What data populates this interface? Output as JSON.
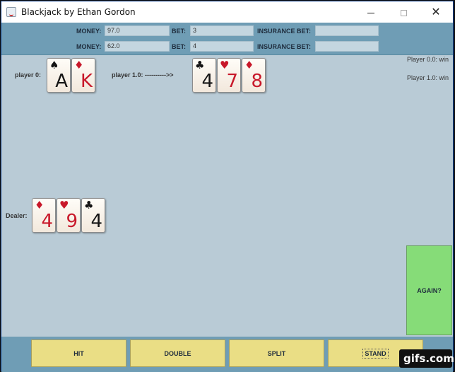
{
  "window": {
    "title": "Blackjack by Ethan Gordon",
    "controls": {
      "minimize": "",
      "maximize": "",
      "close": "✕"
    }
  },
  "bet_panel": {
    "rows": [
      {
        "money_label": "MONEY:",
        "money": "97.0",
        "bet_label": "BET:",
        "bet": "3",
        "insurance_label": "INSURANCE BET:",
        "insurance": ""
      },
      {
        "money_label": "MONEY:",
        "money": "62.0",
        "bet_label": "BET:",
        "bet": "4",
        "insurance_label": "INSURANCE BET:",
        "insurance": ""
      }
    ]
  },
  "players": [
    {
      "label": "player 0:",
      "cards": [
        {
          "rank": "A",
          "suit": "♠",
          "color": "black"
        },
        {
          "rank": "K",
          "suit": "♦",
          "color": "red"
        }
      ]
    },
    {
      "label": "player 1.0: ---------->>",
      "cards": [
        {
          "rank": "4",
          "suit": "♣",
          "color": "black"
        },
        {
          "rank": "7",
          "suit": "♥",
          "color": "red"
        },
        {
          "rank": "8",
          "suit": "♦",
          "color": "red"
        }
      ]
    }
  ],
  "dealer": {
    "label": "Dealer:",
    "cards": [
      {
        "rank": "4",
        "suit": "♦",
        "color": "red"
      },
      {
        "rank": "9",
        "suit": "♥",
        "color": "red"
      },
      {
        "rank": "4",
        "suit": "♣",
        "color": "black"
      }
    ]
  },
  "status": [
    "Player 0.0: win",
    "Player 1.0: win"
  ],
  "again_label": "AGAIN?",
  "actions": {
    "hit": "HIT",
    "double": "DOUBLE",
    "split": "SPLIT",
    "stand": "STAND"
  },
  "watermark": "gifs.com",
  "colors": {
    "panel": "#6f9db5",
    "table": "#b9cbd6",
    "again": "#86dc78",
    "action": "#eade85",
    "red_suit": "#c8182a"
  }
}
